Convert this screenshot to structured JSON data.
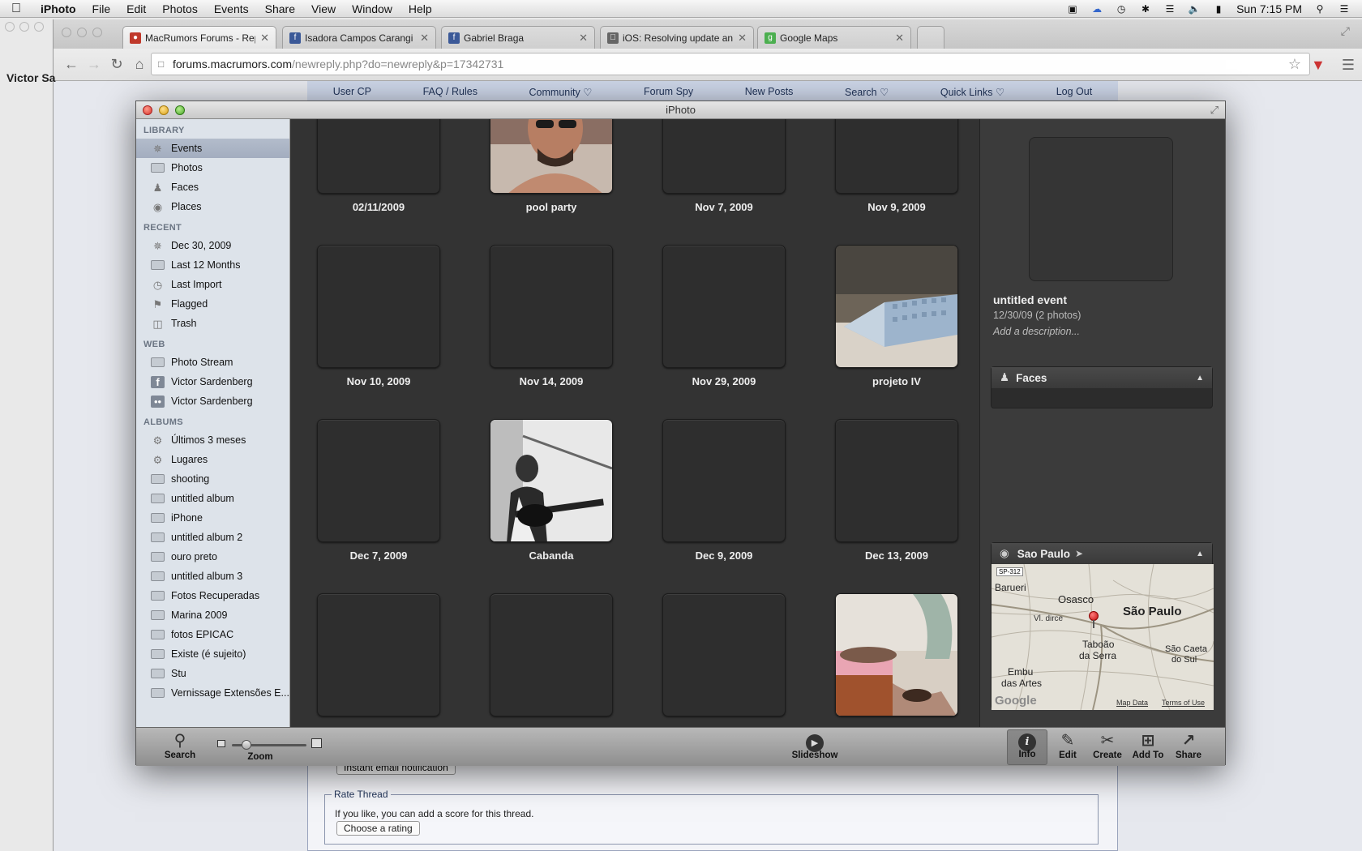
{
  "menubar": {
    "app": "iPhoto",
    "items": [
      "File",
      "Edit",
      "Photos",
      "Events",
      "Share",
      "View",
      "Window",
      "Help"
    ],
    "clock": "Sun 7:15 PM"
  },
  "browser": {
    "tabs": [
      {
        "title": "MacRumors Forums - Rep",
        "favicon": "macrumors-icon",
        "color": "#c0392b"
      },
      {
        "title": "Isadora Campos Carangi",
        "favicon": "facebook-icon",
        "color": "#3b5998"
      },
      {
        "title": "Gabriel Braga",
        "favicon": "facebook-icon",
        "color": "#3b5998"
      },
      {
        "title": "iOS: Resolving update and",
        "favicon": "apple-icon",
        "color": "#555555"
      },
      {
        "title": "Google Maps",
        "favicon": "google-maps-icon",
        "color": "#4caf50"
      }
    ],
    "url_host": "forums.macrumors.com",
    "url_path": "/newreply.php?do=newreply&p=17342731"
  },
  "forum": {
    "nav": [
      "User CP",
      "FAQ / Rules",
      "Community ♡",
      "Forum Spy",
      "New Posts",
      "Search ♡",
      "Quick Links ♡",
      "Log Out"
    ],
    "side_user": "Victor Sa",
    "email_select": "Instant email notification",
    "rate_legend": "Rate Thread",
    "rate_text": "If you like, you can add a score for this thread.",
    "rate_select": "Choose a rating"
  },
  "iphoto": {
    "window_title": "iPhoto",
    "sidebar": {
      "library_head": "LIBRARY",
      "library": [
        {
          "label": "Events",
          "icon": "events-icon"
        },
        {
          "label": "Photos",
          "icon": "photos-icon"
        },
        {
          "label": "Faces",
          "icon": "faces-icon"
        },
        {
          "label": "Places",
          "icon": "places-icon"
        }
      ],
      "recent_head": "RECENT",
      "recent": [
        {
          "label": "Dec 30, 2009",
          "icon": "event-icon"
        },
        {
          "label": "Last 12 Months",
          "icon": "calendar-icon"
        },
        {
          "label": "Last Import",
          "icon": "clock-icon"
        },
        {
          "label": "Flagged",
          "icon": "flag-icon"
        },
        {
          "label": "Trash",
          "icon": "trash-icon"
        }
      ],
      "web_head": "WEB",
      "web": [
        {
          "label": "Photo Stream",
          "icon": "photo-stream-icon"
        },
        {
          "label": "Victor Sardenberg",
          "icon": "facebook-icon"
        },
        {
          "label": "Victor Sardenberg",
          "icon": "flickr-icon"
        }
      ],
      "albums_head": "ALBUMS",
      "albums": [
        {
          "label": "Últimos 3 meses",
          "icon": "smart-album-icon"
        },
        {
          "label": "Lugares",
          "icon": "smart-album-icon"
        },
        {
          "label": "shooting",
          "icon": "album-icon"
        },
        {
          "label": "untitled album",
          "icon": "album-icon"
        },
        {
          "label": "iPhone",
          "icon": "album-icon"
        },
        {
          "label": "untitled album 2",
          "icon": "album-icon"
        },
        {
          "label": "ouro preto",
          "icon": "album-icon"
        },
        {
          "label": "untitled album 3",
          "icon": "album-icon"
        },
        {
          "label": "Fotos Recuperadas",
          "icon": "album-icon"
        },
        {
          "label": "Marina 2009",
          "icon": "album-icon"
        },
        {
          "label": "fotos EPICAC",
          "icon": "album-icon"
        },
        {
          "label": "Existe (é sujeito)",
          "icon": "album-icon"
        },
        {
          "label": "Stu",
          "icon": "album-icon"
        },
        {
          "label": "Vernissage Extensões E...",
          "icon": "album-icon"
        }
      ]
    },
    "events": [
      {
        "label": "02/11/2009",
        "photo": false
      },
      {
        "label": "pool party",
        "photo": true
      },
      {
        "label": "Nov 7, 2009",
        "photo": false
      },
      {
        "label": "Nov 9, 2009",
        "photo": false
      },
      {
        "label": "Nov 10, 2009",
        "photo": false
      },
      {
        "label": "Nov 14, 2009",
        "photo": false
      },
      {
        "label": "Nov 29, 2009",
        "photo": false
      },
      {
        "label": "projeto IV",
        "photo": true
      },
      {
        "label": "Dec 7, 2009",
        "photo": false
      },
      {
        "label": "Cabanda",
        "photo": true
      },
      {
        "label": "Dec 9, 2009",
        "photo": false
      },
      {
        "label": "Dec 13, 2009",
        "photo": false
      },
      {
        "label": "",
        "photo": false
      },
      {
        "label": "",
        "photo": false
      },
      {
        "label": "",
        "photo": false
      },
      {
        "label": "",
        "photo": true
      }
    ],
    "info": {
      "event_name": "untitled event",
      "event_date": "12/30/09 (2 photos)",
      "description_placeholder": "Add a description...",
      "faces_title": "Faces",
      "place_title": "Sao Paulo",
      "map_labels": [
        "SP-312",
        "Barueri",
        "Osasco",
        "São Paulo",
        "Vl. dirce",
        "Taboão",
        "da Serra",
        "Embu",
        "das Artes",
        "São Caeta",
        "do Sul",
        "Map Data",
        "Terms of Use",
        "Google"
      ]
    },
    "bottom": {
      "search": "Search",
      "zoom": "Zoom",
      "slideshow": "Slideshow",
      "info": "Info",
      "edit": "Edit",
      "create": "Create",
      "add_to": "Add To",
      "share": "Share"
    }
  }
}
